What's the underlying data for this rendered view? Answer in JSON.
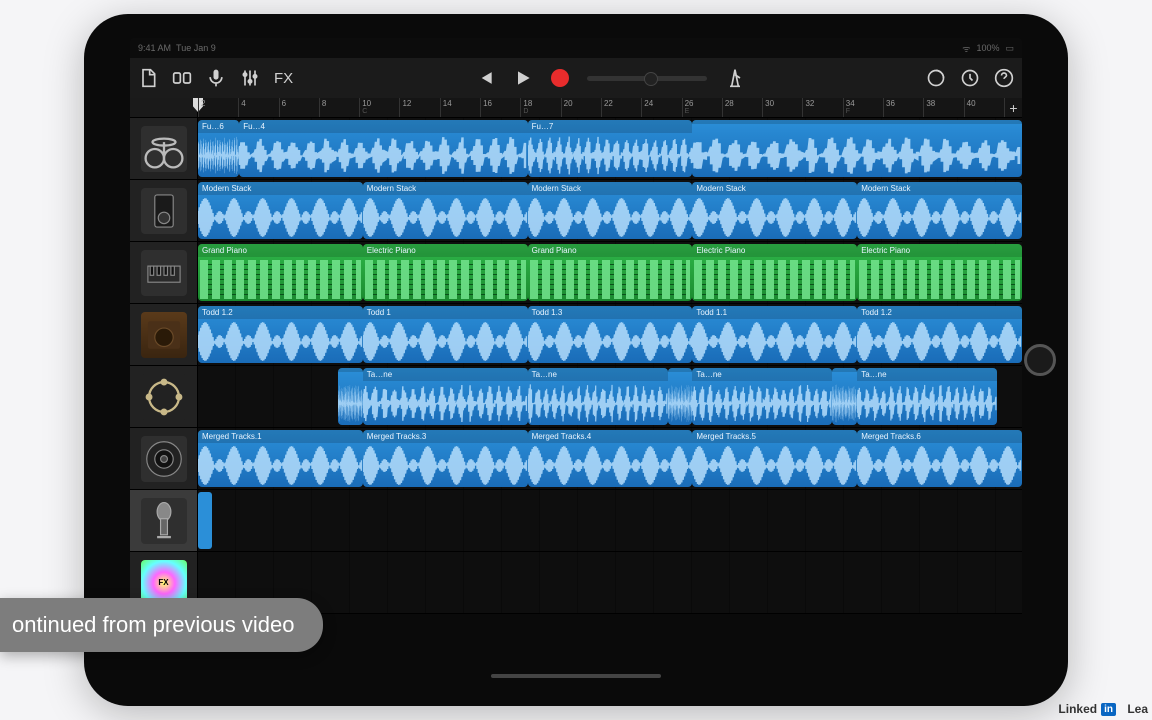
{
  "status": {
    "time": "9:41 AM",
    "date": "Tue Jan 9",
    "battery": "100%"
  },
  "toolbar": {
    "fx": "FX"
  },
  "ruler": {
    "marks": [
      {
        "n": "2",
        "k": ""
      },
      {
        "n": "4",
        "k": ""
      },
      {
        "n": "6",
        "k": ""
      },
      {
        "n": "8",
        "k": ""
      },
      {
        "n": "10",
        "k": "C"
      },
      {
        "n": "12",
        "k": ""
      },
      {
        "n": "14",
        "k": ""
      },
      {
        "n": "16",
        "k": ""
      },
      {
        "n": "18",
        "k": "D"
      },
      {
        "n": "20",
        "k": ""
      },
      {
        "n": "22",
        "k": ""
      },
      {
        "n": "24",
        "k": ""
      },
      {
        "n": "26",
        "k": "E"
      },
      {
        "n": "28",
        "k": ""
      },
      {
        "n": "30",
        "k": ""
      },
      {
        "n": "32",
        "k": ""
      },
      {
        "n": "34",
        "k": "F"
      },
      {
        "n": "36",
        "k": ""
      },
      {
        "n": "38",
        "k": ""
      },
      {
        "n": "40",
        "k": ""
      }
    ],
    "add": "+"
  },
  "tracks": [
    {
      "id": "drums",
      "instr": "drumkit",
      "kind": "audio",
      "regions": [
        {
          "l": "Fu…6",
          "s": 0,
          "e": 5
        },
        {
          "l": "Fu…4",
          "s": 5,
          "e": 40
        },
        {
          "l": "Fu…7",
          "s": 40,
          "e": 60
        },
        {
          "l": "",
          "s": 60,
          "e": 100
        }
      ]
    },
    {
      "id": "stack",
      "instr": "stack",
      "kind": "audio",
      "regions": [
        {
          "l": "Modern Stack",
          "s": 0,
          "e": 20
        },
        {
          "l": "Modern Stack",
          "s": 20,
          "e": 40
        },
        {
          "l": "Modern Stack",
          "s": 40,
          "e": 60
        },
        {
          "l": "Modern Stack",
          "s": 60,
          "e": 80
        },
        {
          "l": "Modern Stack",
          "s": 80,
          "e": 100
        }
      ]
    },
    {
      "id": "piano",
      "instr": "piano",
      "kind": "midi",
      "regions": [
        {
          "l": "Grand Piano",
          "s": 0,
          "e": 20
        },
        {
          "l": "Electric Piano",
          "s": 20,
          "e": 40
        },
        {
          "l": "Grand Piano",
          "s": 40,
          "e": 60
        },
        {
          "l": "Electric Piano",
          "s": 60,
          "e": 80
        },
        {
          "l": "Electric Piano",
          "s": 80,
          "e": 100
        }
      ]
    },
    {
      "id": "guitar",
      "instr": "amp",
      "kind": "audio",
      "regions": [
        {
          "l": "Todd 1.2",
          "s": 0,
          "e": 20
        },
        {
          "l": "Todd 1",
          "s": 20,
          "e": 40
        },
        {
          "l": "Todd 1.3",
          "s": 40,
          "e": 60
        },
        {
          "l": "Todd 1.1",
          "s": 60,
          "e": 80
        },
        {
          "l": "Todd 1.2",
          "s": 80,
          "e": 100
        }
      ]
    },
    {
      "id": "tamb",
      "instr": "tambourine",
      "kind": "audio",
      "regions": [
        {
          "l": "",
          "s": 17,
          "e": 20
        },
        {
          "l": "Ta…ne",
          "s": 20,
          "e": 40
        },
        {
          "l": "Ta…ne",
          "s": 40,
          "e": 57
        },
        {
          "l": "",
          "s": 57,
          "e": 60
        },
        {
          "l": "Ta…ne",
          "s": 60,
          "e": 77
        },
        {
          "l": "",
          "s": 77,
          "e": 80
        },
        {
          "l": "Ta…ne",
          "s": 80,
          "e": 97
        }
      ]
    },
    {
      "id": "merged",
      "instr": "speaker",
      "kind": "audio",
      "regions": [
        {
          "l": "Merged Tracks.1",
          "s": 0,
          "e": 20
        },
        {
          "l": "Merged Tracks.3",
          "s": 20,
          "e": 40
        },
        {
          "l": "Merged Tracks.4",
          "s": 40,
          "e": 60
        },
        {
          "l": "Merged Tracks.5",
          "s": 60,
          "e": 80
        },
        {
          "l": "Merged Tracks.6",
          "s": 80,
          "e": 100
        }
      ]
    },
    {
      "id": "mic",
      "instr": "mic",
      "kind": "audio",
      "sel": true,
      "stub": true,
      "regions": []
    },
    {
      "id": "fx",
      "instr": "fx",
      "kind": "audio",
      "regions": []
    }
  ],
  "banner": "ontinued from previous video",
  "logo": {
    "brand": "Linked",
    "box": "in",
    "tail": "Lea"
  }
}
